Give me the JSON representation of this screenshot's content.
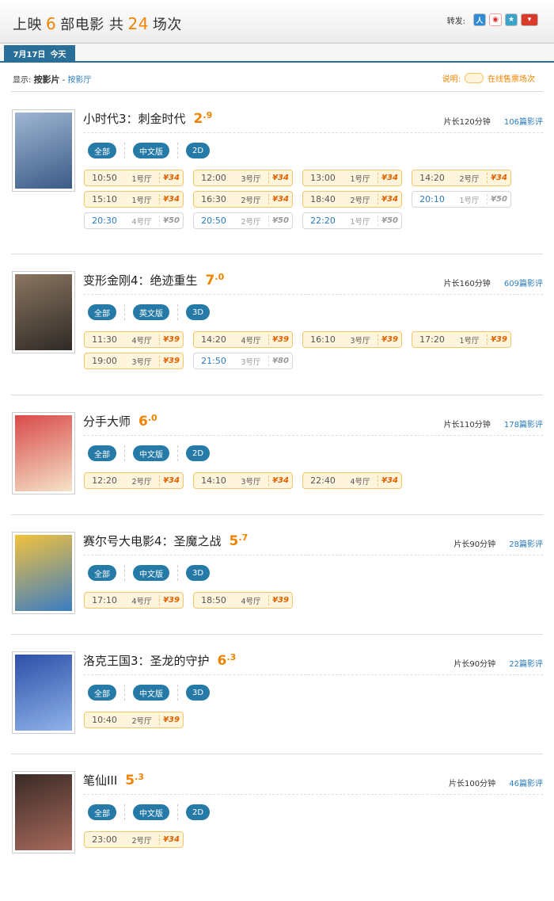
{
  "header": {
    "prefix": "上映",
    "movie_count": "6",
    "mid": "部电影 共",
    "session_count": "24",
    "suffix": "场次",
    "share_label": "转发:"
  },
  "date_tab": {
    "date": "7月17日",
    "day": "今天"
  },
  "view_options": {
    "label": "显示:",
    "by_movie": "按影片",
    "separator": "-",
    "by_hall": "按影厅"
  },
  "legend": {
    "label": "说明:",
    "text": "在线售票场次"
  },
  "movies": [
    {
      "title": "小时代3：刺金时代",
      "score_int": "2",
      "score_dec": ".9",
      "length": "片长120分钟",
      "reviews": "106篇影评",
      "filters": [
        "全部",
        "中文版",
        "2D"
      ],
      "showtimes": [
        {
          "time": "10:50",
          "hall": "1号厅",
          "price": "¥34",
          "online": true
        },
        {
          "time": "12:00",
          "hall": "3号厅",
          "price": "¥34",
          "online": true
        },
        {
          "time": "13:00",
          "hall": "1号厅",
          "price": "¥34",
          "online": true
        },
        {
          "time": "14:20",
          "hall": "2号厅",
          "price": "¥34",
          "online": true
        },
        {
          "time": "15:10",
          "hall": "1号厅",
          "price": "¥34",
          "online": true
        },
        {
          "time": "16:30",
          "hall": "2号厅",
          "price": "¥34",
          "online": true
        },
        {
          "time": "18:40",
          "hall": "2号厅",
          "price": "¥34",
          "online": true
        },
        {
          "time": "20:10",
          "hall": "1号厅",
          "price": "¥50",
          "online": false
        },
        {
          "time": "20:30",
          "hall": "4号厅",
          "price": "¥50",
          "online": false
        },
        {
          "time": "20:50",
          "hall": "2号厅",
          "price": "¥50",
          "online": false
        },
        {
          "time": "22:20",
          "hall": "1号厅",
          "price": "¥50",
          "online": false
        }
      ]
    },
    {
      "title": "变形金刚4：绝迹重生",
      "score_int": "7",
      "score_dec": ".0",
      "length": "片长160分钟",
      "reviews": "609篇影评",
      "filters": [
        "全部",
        "英文版",
        "3D"
      ],
      "showtimes": [
        {
          "time": "11:30",
          "hall": "4号厅",
          "price": "¥39",
          "online": true
        },
        {
          "time": "14:20",
          "hall": "4号厅",
          "price": "¥39",
          "online": true
        },
        {
          "time": "16:10",
          "hall": "3号厅",
          "price": "¥39",
          "online": true
        },
        {
          "time": "17:20",
          "hall": "1号厅",
          "price": "¥39",
          "online": true
        },
        {
          "time": "19:00",
          "hall": "3号厅",
          "price": "¥39",
          "online": true
        },
        {
          "time": "21:50",
          "hall": "3号厅",
          "price": "¥80",
          "online": false
        }
      ]
    },
    {
      "title": "分手大师",
      "score_int": "6",
      "score_dec": ".0",
      "length": "片长110分钟",
      "reviews": "178篇影评",
      "filters": [
        "全部",
        "中文版",
        "2D"
      ],
      "showtimes": [
        {
          "time": "12:20",
          "hall": "2号厅",
          "price": "¥34",
          "online": true
        },
        {
          "time": "14:10",
          "hall": "3号厅",
          "price": "¥34",
          "online": true
        },
        {
          "time": "22:40",
          "hall": "4号厅",
          "price": "¥34",
          "online": true
        }
      ]
    },
    {
      "title": "赛尔号大电影4：圣魔之战",
      "score_int": "5",
      "score_dec": ".7",
      "length": "片长90分钟",
      "reviews": "28篇影评",
      "filters": [
        "全部",
        "中文版",
        "3D"
      ],
      "showtimes": [
        {
          "time": "17:10",
          "hall": "4号厅",
          "price": "¥39",
          "online": true
        },
        {
          "time": "18:50",
          "hall": "4号厅",
          "price": "¥39",
          "online": true
        }
      ]
    },
    {
      "title": "洛克王国3：圣龙的守护",
      "score_int": "6",
      "score_dec": ".3",
      "length": "片长90分钟",
      "reviews": "22篇影评",
      "filters": [
        "全部",
        "中文版",
        "3D"
      ],
      "showtimes": [
        {
          "time": "10:40",
          "hall": "2号厅",
          "price": "¥39",
          "online": true
        }
      ]
    },
    {
      "title": "笔仙III",
      "score_int": "5",
      "score_dec": ".3",
      "length": "片长100分钟",
      "reviews": "46篇影评",
      "filters": [
        "全部",
        "中文版",
        "2D"
      ],
      "showtimes": [
        {
          "time": "23:00",
          "hall": "2号厅",
          "price": "¥34",
          "online": true
        }
      ]
    }
  ],
  "colors": {
    "accent": "#f08300",
    "brand_blue": "#257aa8",
    "online_bg": "#fff5dc",
    "online_border": "#f4c56b",
    "link": "#2a7bbf"
  }
}
